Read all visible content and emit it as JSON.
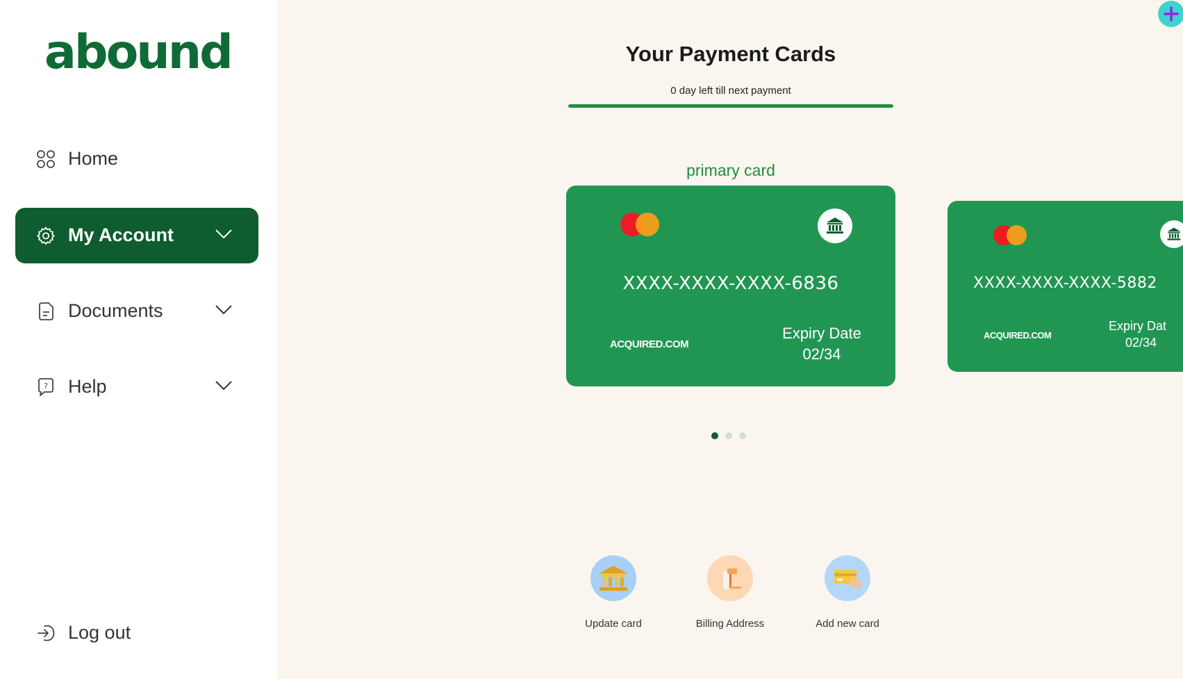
{
  "brand": {
    "logo_text": "abound",
    "color": "#0f6b35"
  },
  "sidebar": {
    "items": [
      {
        "label": "Home",
        "icon": "grid-icon",
        "expandable": false,
        "active": false
      },
      {
        "label": "My Account",
        "icon": "gear-icon",
        "expandable": true,
        "active": true
      },
      {
        "label": "Documents",
        "icon": "document-icon",
        "expandable": true,
        "active": false
      },
      {
        "label": "Help",
        "icon": "help-icon",
        "expandable": true,
        "active": false
      }
    ],
    "logout_label": "Log out"
  },
  "header": {
    "title": "Your Payment Cards",
    "countdown": "0 day left till next payment",
    "progress_fraction": 1.0
  },
  "cards": {
    "primary_label": "primary card",
    "items": [
      {
        "number": "XXXX-XXXX-XXXX-6836",
        "issuer": "ACQUIRED.COM",
        "expiry_label": "Expiry Date",
        "expiry": "02/34"
      },
      {
        "number": "XXXX-XXXX-XXXX-5882",
        "issuer": "ACQUIRED.COM",
        "expiry_label": "Expiry Dat",
        "expiry": "02/34"
      }
    ],
    "pagination": {
      "total": 3,
      "current": 1
    }
  },
  "actions": [
    {
      "label": "Update card",
      "icon": "bank-icon"
    },
    {
      "label": "Billing Address",
      "icon": "address-icon"
    },
    {
      "label": "Add new card",
      "icon": "card-hand-icon"
    }
  ],
  "colors": {
    "accent": "#219653",
    "dark_accent": "#0e5c2f",
    "background": "#faf6ef",
    "add_button": "#3fd3cf"
  }
}
